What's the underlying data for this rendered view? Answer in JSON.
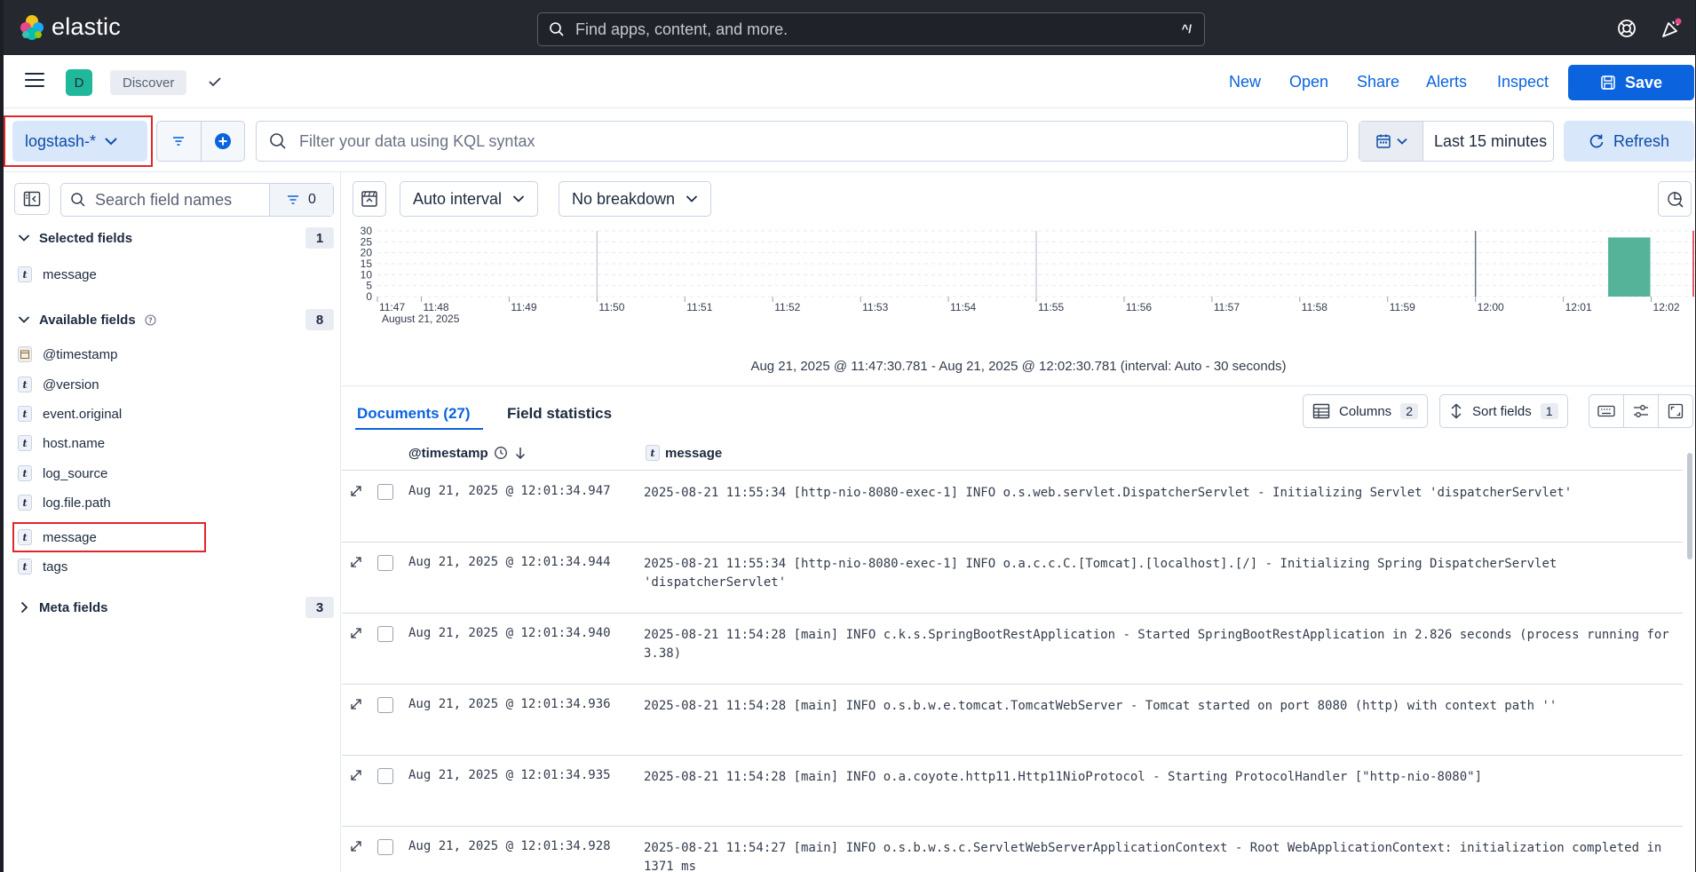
{
  "topbar": {
    "brand": "elastic",
    "search_placeholder": "Find apps, content, and more.",
    "search_shortcut": "^/"
  },
  "appbar": {
    "space_initial": "D",
    "breadcrumb": "Discover",
    "links": [
      "New",
      "Open",
      "Share",
      "Alerts",
      "Inspect"
    ],
    "save_label": "Save"
  },
  "querybar": {
    "data_view": "logstash-*",
    "kql_placeholder": "Filter your data using KQL syntax",
    "time_range": "Last 15 minutes",
    "refresh_label": "Refresh"
  },
  "sidebar": {
    "search_placeholder": "Search field names",
    "filter_count": "0",
    "selected": {
      "title": "Selected fields",
      "count": "1",
      "fields": [
        {
          "name": "message",
          "type": "t"
        }
      ]
    },
    "available": {
      "title": "Available fields",
      "count": "8",
      "fields": [
        {
          "name": "@timestamp",
          "type": "date"
        },
        {
          "name": "@version",
          "type": "t"
        },
        {
          "name": "event.original",
          "type": "t"
        },
        {
          "name": "host.name",
          "type": "t"
        },
        {
          "name": "log_source",
          "type": "t"
        },
        {
          "name": "log.file.path",
          "type": "t"
        },
        {
          "name": "message",
          "type": "t"
        },
        {
          "name": "tags",
          "type": "t"
        }
      ]
    },
    "meta": {
      "title": "Meta fields",
      "count": "3"
    }
  },
  "chart_toolbar": {
    "interval": "Auto interval",
    "breakdown": "No breakdown"
  },
  "chart_data": {
    "type": "bar",
    "x_ticks": [
      "11:47",
      "11:48",
      "11:49",
      "11:50",
      "11:51",
      "11:52",
      "11:53",
      "11:54",
      "11:55",
      "11:56",
      "11:57",
      "11:58",
      "11:59",
      "12:00",
      "12:01",
      "12:02"
    ],
    "x_sub_label": "August 21, 2025",
    "y_ticks": [
      "0",
      "5",
      "10",
      "15",
      "20",
      "25",
      "30"
    ],
    "ylim": [
      0,
      30
    ],
    "bars": [
      {
        "start": "12:01:30",
        "end": "12:02:00",
        "value": 27
      }
    ],
    "bar_color": "#54b399",
    "now_marker_color": "#e0262b",
    "caption": "Aug 21, 2025 @ 11:47:30.781 - Aug 21, 2025 @ 12:02:30.781 (interval: Auto - 30 seconds)"
  },
  "documents": {
    "tab_documents": "Documents (27)",
    "tab_field_stats": "Field statistics",
    "columns_label": "Columns",
    "columns_count": "2",
    "sort_label": "Sort fields",
    "sort_count": "1",
    "header_timestamp": "@timestamp",
    "header_message": "message",
    "rows": [
      {
        "ts": "Aug 21, 2025 @ 12:01:34.947",
        "msg": "2025-08-21 11:55:34 [http-nio-8080-exec-1] INFO  o.s.web.servlet.DispatcherServlet - Initializing Servlet 'dispatcherServlet'"
      },
      {
        "ts": "Aug 21, 2025 @ 12:01:34.944",
        "msg": "2025-08-21 11:55:34 [http-nio-8080-exec-1] INFO  o.a.c.c.C.[Tomcat].[localhost].[/] - Initializing Spring DispatcherServlet 'dispatcherServlet'"
      },
      {
        "ts": "Aug 21, 2025 @ 12:01:34.940",
        "msg": "2025-08-21 11:54:28 [main] INFO  c.k.s.SpringBootRestApplication - Started SpringBootRestApplication in 2.826 seconds (process running for 3.38)"
      },
      {
        "ts": "Aug 21, 2025 @ 12:01:34.936",
        "msg": "2025-08-21 11:54:28 [main] INFO  o.s.b.w.e.tomcat.TomcatWebServer - Tomcat started on port 8080 (http) with context path ''"
      },
      {
        "ts": "Aug 21, 2025 @ 12:01:34.935",
        "msg": "2025-08-21 11:54:28 [main] INFO  o.a.coyote.http11.Http11NioProtocol - Starting ProtocolHandler [\"http-nio-8080\"]"
      },
      {
        "ts": "Aug 21, 2025 @ 12:01:34.928",
        "msg": "2025-08-21 11:54:27 [main] INFO  o.s.b.w.s.c.ServletWebServerApplicationContext - Root WebApplicationContext: initialization completed in 1371 ms"
      }
    ]
  }
}
